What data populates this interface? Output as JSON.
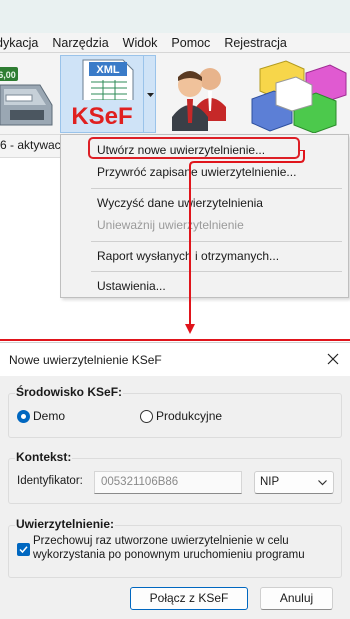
{
  "app": {
    "menu": [
      "dykacja",
      "Narzędzia",
      "Widok",
      "Pomoc",
      "Rejestracja"
    ],
    "toolbar": {
      "printer_display": "6,00",
      "ksef_logo_text": "KSeF",
      "xml_label": "XML"
    },
    "status_text": "6 - aktywac"
  },
  "dropdown": {
    "items": [
      {
        "label": "Utwórz nowe uwierzytelnienie...",
        "enabled": true,
        "highlighted": true
      },
      {
        "label": "Przywróć zapisane uwierzytelnienie...",
        "enabled": true
      },
      {
        "label": "Wyczyść dane uwierzytelnienia",
        "enabled": true
      },
      {
        "label": "Unieważnij uwierzytelnienie",
        "enabled": false
      },
      {
        "label": "Raport wysłanych i otrzymanych...",
        "enabled": true
      },
      {
        "label": "Ustawienia...",
        "enabled": true
      }
    ]
  },
  "dialog": {
    "title": "Nowe uwierzytelnienie KSeF",
    "environment": {
      "label": "Środowisko KSeF:",
      "options": [
        "Demo",
        "Produkcyjne"
      ],
      "selected": "Demo"
    },
    "context": {
      "label": "Kontekst:",
      "id_label": "Identyfikator:",
      "id_value": "005321106B86",
      "id_type": "NIP"
    },
    "auth": {
      "label": "Uwierzytelnienie:",
      "checkbox_text_line1": "Przechowuj raz utworzone uwierzytelnienie w celu",
      "checkbox_text_line2": "wykorzystania po ponownym uruchomieniu programu",
      "checked": true
    },
    "buttons": {
      "connect": "Połącz z KSeF",
      "cancel": "Anuluj"
    }
  },
  "colors": {
    "accent": "#0067c0",
    "highlight_red": "#e0141b",
    "ksef_red": "#e02020"
  }
}
